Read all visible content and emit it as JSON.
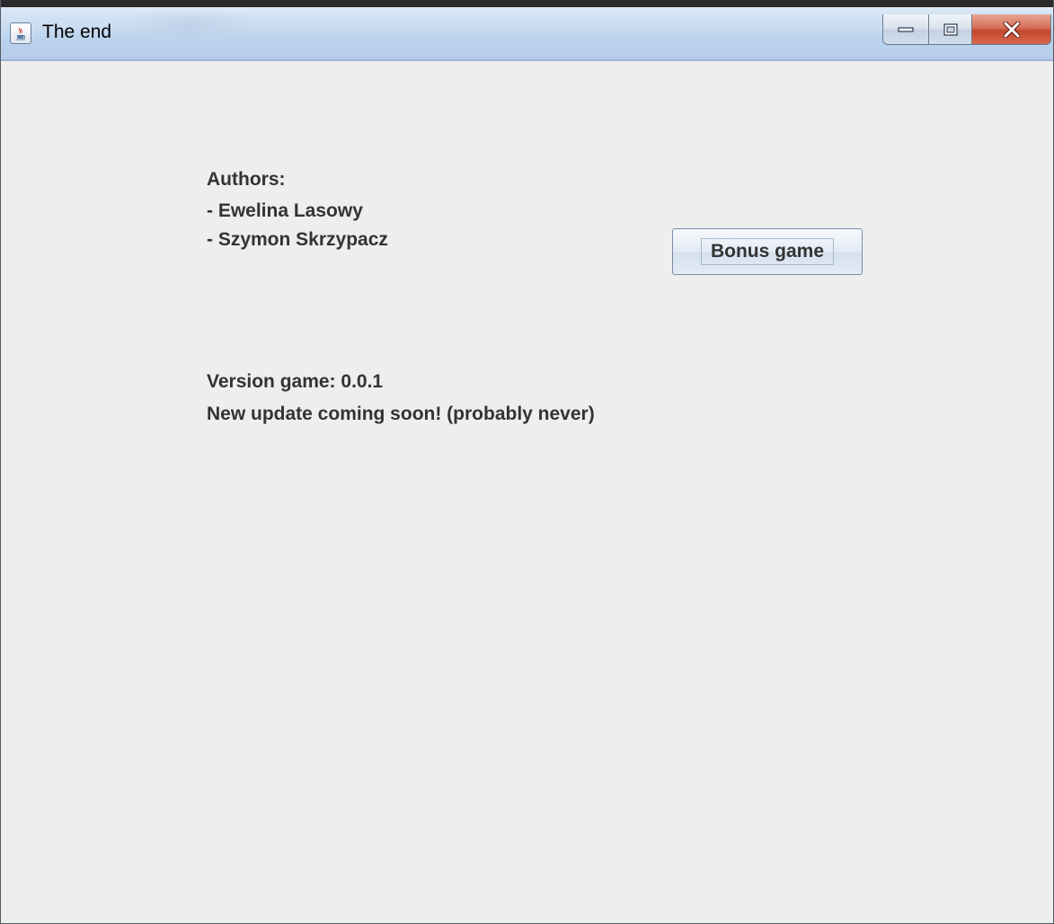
{
  "window": {
    "title": "The end",
    "controls": [
      "minimize",
      "maximize",
      "close"
    ]
  },
  "authors": {
    "heading": "Authors:",
    "names": [
      "- Ewelina Lasowy",
      "- Szymon Skrzypacz"
    ]
  },
  "bonus_button": {
    "label": "Bonus game"
  },
  "version": {
    "line": "Version game: 0.0.1",
    "note": "New update coming soon! (probably never)"
  },
  "colors": {
    "background": "#eeeeee",
    "text": "#333333",
    "close_button": "#c4472c"
  },
  "icons": {
    "app": "java-cup-icon",
    "minimize": "minimize-icon",
    "maximize": "maximize-icon",
    "close": "close-icon"
  }
}
